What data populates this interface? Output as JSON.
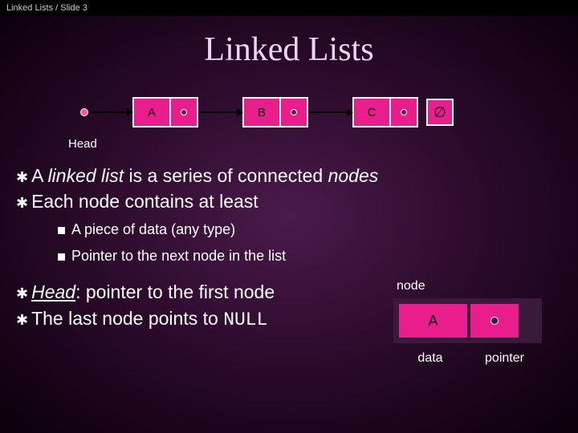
{
  "header": {
    "breadcrumb": "Linked Lists / Slide 3"
  },
  "title": "Linked Lists",
  "diagram": {
    "nodes": [
      "A",
      "B",
      "C"
    ],
    "null_symbol": "∅",
    "head_label": "Head"
  },
  "bullets": {
    "b1_pre": "A ",
    "b1_em": "linked list",
    "b1_post": " is a series of connected ",
    "b1_em2": "nodes",
    "b2": "Each node contains at least",
    "s1": "A piece of data (any type)",
    "s2": "Pointer to the next node in the list",
    "b3_em": "Head",
    "b3_post": ": pointer to the first node",
    "b4_pre": "The last node points to ",
    "b4_mono": "NULL"
  },
  "node_fig": {
    "caption": "node",
    "data_val": "A",
    "label_data": "data",
    "label_ptr": "pointer"
  }
}
